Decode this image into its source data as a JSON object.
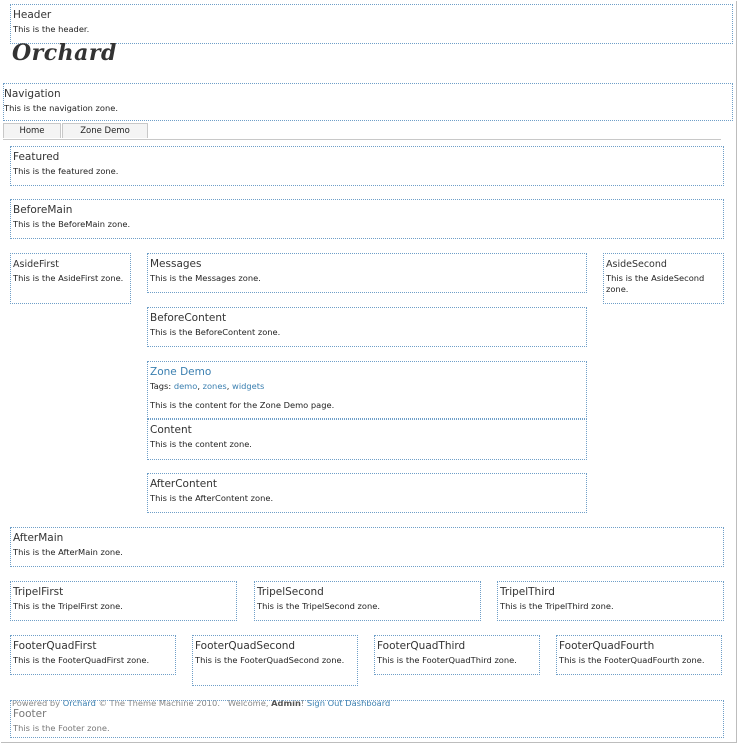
{
  "header": {
    "title": "Header",
    "desc": "This is the header."
  },
  "logo": "Orchard",
  "navigation": {
    "title": "Navigation",
    "desc": "This is the navigation zone."
  },
  "nav_tabs": [
    "Home",
    "Zone Demo"
  ],
  "featured": {
    "title": "Featured",
    "desc": "This is the featured zone."
  },
  "before_main": {
    "title": "BeforeMain",
    "desc": "This is the BeforeMain zone."
  },
  "aside_first": {
    "title": "AsideFirst",
    "desc": "This is the AsideFirst zone."
  },
  "messages": {
    "title": "Messages",
    "desc": "This is the Messages zone."
  },
  "aside_second": {
    "title": "AsideSecond",
    "desc": "This is the AsideSecond zone."
  },
  "before_content": {
    "title": "BeforeContent",
    "desc": "This is the BeforeContent zone."
  },
  "zone_demo": {
    "title": "Zone Demo",
    "tags_label": "Tags:",
    "tags": [
      "demo",
      "zones",
      "widgets"
    ],
    "tag_sep": ",",
    "body": "This is the content for the Zone Demo page."
  },
  "content": {
    "title": "Content",
    "desc": "This is the content zone."
  },
  "after_content": {
    "title": "AfterContent",
    "desc": "This is the AfterContent zone."
  },
  "after_main": {
    "title": "AfterMain",
    "desc": "This is the AfterMain zone."
  },
  "tripel_first": {
    "title": "TripelFirst",
    "desc": "This is the TripelFirst zone."
  },
  "tripel_second": {
    "title": "TripelSecond",
    "desc": "This is the TripelSecond zone."
  },
  "tripel_third": {
    "title": "TripelThird",
    "desc": "This is the TripelThird zone."
  },
  "footer_quad_first": {
    "title": "FooterQuadFirst",
    "desc": "This is the FooterQuadFirst zone."
  },
  "footer_quad_second": {
    "title": "FooterQuadSecond",
    "desc": "This is the FooterQuadSecond zone."
  },
  "footer_quad_third": {
    "title": "FooterQuadThird",
    "desc": "This is the FooterQuadThird zone."
  },
  "footer_quad_fourth": {
    "title": "FooterQuadFourth",
    "desc": "This is the FooterQuadFourth zone."
  },
  "powered": {
    "prefix": "Powered by",
    "link": "Orchard",
    "suffix": "© The Theme Machine 2010.",
    "welcome": "Welcome,",
    "user": "Admin",
    "excl": "!",
    "sign_out": "Sign Out",
    "dashboard": "Dashboard"
  },
  "footer": {
    "title": "Footer",
    "desc": "This is the Footer zone."
  },
  "colors": {
    "accent": "#3a7fb0",
    "zone_border": "#6f9fc8"
  }
}
